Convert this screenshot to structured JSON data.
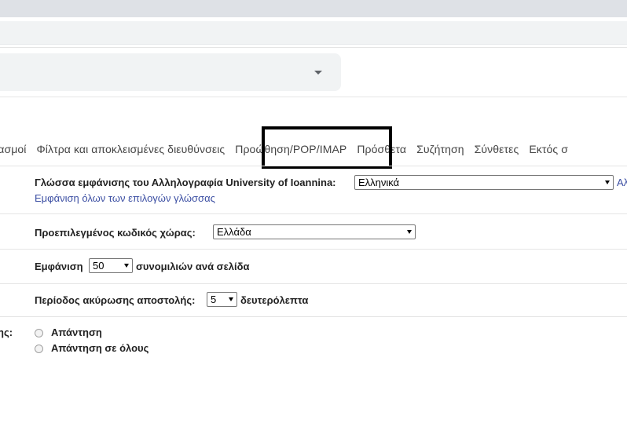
{
  "tabs": [
    {
      "label": "ριασμοί"
    },
    {
      "label": "Φίλτρα και αποκλεισμένες διευθύνσεις"
    },
    {
      "label": "Προώθηση/POP/IMAP"
    },
    {
      "label": "Πρόσθετα"
    },
    {
      "label": "Συζήτηση"
    },
    {
      "label": "Σύνθετες"
    },
    {
      "label": "Εκτός σ"
    }
  ],
  "language": {
    "label": "Γλώσσα εμφάνισης του Αλληλογραφία University of Ioannina:",
    "value": "Ελληνικά",
    "truncated_link": "Αλ",
    "show_all_link": "Εμφάνιση όλων των επιλογών γλώσσας"
  },
  "country": {
    "label": "Προεπιλεγμένος κωδικός χώρας:",
    "value": "Ελλάδα"
  },
  "page_size": {
    "prefix": "Εμφάνιση",
    "value": "50",
    "suffix": "συνομιλιών ανά σελίδα"
  },
  "undo_send": {
    "label": "Περίοδος ακύρωσης αποστολής:",
    "value": "5",
    "suffix": "δευτερόλεπτα"
  },
  "reply": {
    "truncated_label": "ης:",
    "options": [
      "Απάντηση",
      "Απάντηση σε όλους"
    ]
  }
}
